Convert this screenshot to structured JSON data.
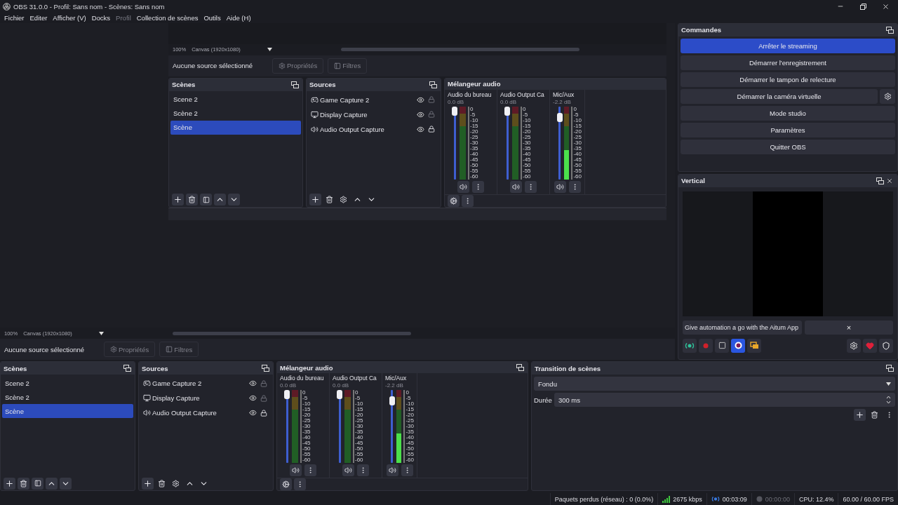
{
  "window": {
    "title": "OBS 31.0.0 - Profil: Sans nom - Scènes: Sans nom"
  },
  "menu": [
    {
      "label": "Fichier",
      "disabled": false
    },
    {
      "label": "Editer",
      "disabled": false
    },
    {
      "label": "Afficher (V)",
      "disabled": false
    },
    {
      "label": "Docks",
      "disabled": false
    },
    {
      "label": "Profil",
      "disabled": true
    },
    {
      "label": "Collection de scènes",
      "disabled": false
    },
    {
      "label": "Outils",
      "disabled": false
    },
    {
      "label": "Aide (H)",
      "disabled": false
    }
  ],
  "preview": {
    "capture": {
      "zoom_bar": {
        "zoom": "100%",
        "canvas": "Canvas (1920x1080)"
      },
      "info_bar": {
        "label": "Aucune source sélectionné",
        "buttons": [
          {
            "kind": "properties",
            "label": "Propriétés",
            "disabled": true
          },
          {
            "kind": "filters",
            "label": "Filtres",
            "disabled": true
          }
        ]
      },
      "scenes": {
        "title": "Scènes",
        "items": [
          {
            "label": "Scene 2",
            "selected": false
          },
          {
            "label": "Scène 2",
            "selected": false
          },
          {
            "label": "Scène",
            "selected": true
          }
        ]
      },
      "sources": {
        "title": "Sources",
        "items": [
          {
            "label": "Game Capture 2",
            "kind": "game",
            "visible": true,
            "locked": false
          },
          {
            "label": "Display Capture",
            "kind": "display",
            "visible": true,
            "locked": false
          },
          {
            "label": "Audio Output Capture",
            "kind": "audio",
            "visible": true,
            "locked": true
          }
        ]
      },
      "mixer": {
        "title": "Mélangeur audio",
        "channels": [
          {
            "name": "Audio du bureau",
            "reading": "0.0 dB",
            "volume": {
              "level": 1
            },
            "scale": [
              "0",
              "-5",
              "-10",
              "-15",
              "-20",
              "-25",
              "-30",
              "-35",
              "-40",
              "-45",
              "-50",
              "-55",
              "-60"
            ]
          },
          {
            "name": "Audio Output Ca",
            "reading": "0.0 dB",
            "volume": {
              "level": 1
            },
            "scale": [
              "0",
              "-5",
              "-10",
              "-15",
              "-20",
              "-25",
              "-30",
              "-35",
              "-40",
              "-45",
              "-50",
              "-55",
              "-60"
            ]
          },
          {
            "name": "Mic/Aux",
            "reading": "-2.2 dB",
            "volume": {
              "level": 0.9
            },
            "meter": {
              "level": 0.4
            },
            "scale": [
              "0",
              "-5",
              "-10",
              "-15",
              "-20",
              "-25",
              "-30",
              "-35",
              "-40",
              "-45",
              "-50",
              "-55",
              "-60"
            ]
          }
        ]
      }
    }
  },
  "zoom_bar": {
    "zoom": "100%",
    "canvas": "Canvas (1920x1080)"
  },
  "info_bar": {
    "label": "Aucune source sélectionné",
    "buttons": [
      {
        "kind": "properties",
        "label": "Propriétés",
        "disabled": true
      },
      {
        "kind": "filters",
        "label": "Filtres",
        "disabled": true
      }
    ]
  },
  "commands": {
    "title": "Commandes",
    "buttons": [
      {
        "label": "Arrêter le streaming",
        "active": true,
        "kind": "plain"
      },
      {
        "label": "Démarrer l'enregistrement",
        "active": false,
        "kind": "plain"
      },
      {
        "label": "Démarrer le tampon de relecture",
        "active": false,
        "kind": "plain"
      },
      {
        "label": "Démarrer la caméra virtuelle",
        "active": false,
        "kind": "with_settings"
      },
      {
        "label": "Mode studio",
        "active": false,
        "kind": "plain"
      },
      {
        "label": "Paramètres",
        "active": false,
        "kind": "plain"
      },
      {
        "label": "Quitter OBS",
        "active": false,
        "kind": "plain"
      }
    ]
  },
  "vertical": {
    "title": "Vertical",
    "closable": true,
    "banner": "Give automation a go with the Aitum App",
    "banner_close": "×",
    "toolbar": [
      {
        "kind": "stream",
        "active": false
      },
      {
        "kind": "record",
        "active": false
      },
      {
        "kind": "stop",
        "active": false
      },
      {
        "kind": "replay",
        "active": true
      },
      {
        "kind": "screens",
        "active": false
      },
      {
        "kind": "settings",
        "active": false
      },
      {
        "kind": "heart",
        "active": false
      },
      {
        "kind": "badge",
        "active": false
      }
    ]
  },
  "scenes": {
    "title": "Scènes",
    "items": [
      {
        "label": "Scene 2",
        "selected": false
      },
      {
        "label": "Scène 2",
        "selected": false
      },
      {
        "label": "Scène",
        "selected": true
      }
    ]
  },
  "sources": {
    "title": "Sources",
    "items": [
      {
        "label": "Game Capture 2",
        "kind": "game",
        "visible": true,
        "locked": false
      },
      {
        "label": "Display Capture",
        "kind": "display",
        "visible": true,
        "locked": false
      },
      {
        "label": "Audio Output Capture",
        "kind": "audio",
        "visible": true,
        "locked": true
      }
    ]
  },
  "mixer": {
    "title": "Mélangeur audio",
    "channels": [
      {
        "name": "Audio du bureau",
        "reading": "0.0 dB",
        "volume": {
          "level": 1
        },
        "scale": [
          "0",
          "-5",
          "-10",
          "-15",
          "-20",
          "-25",
          "-30",
          "-35",
          "-40",
          "-45",
          "-50",
          "-55",
          "-60"
        ]
      },
      {
        "name": "Audio Output Ca",
        "reading": "0.0 dB",
        "volume": {
          "level": 1
        },
        "scale": [
          "0",
          "-5",
          "-10",
          "-15",
          "-20",
          "-25",
          "-30",
          "-35",
          "-40",
          "-45",
          "-50",
          "-55",
          "-60"
        ]
      },
      {
        "name": "Mic/Aux",
        "reading": "-2.2 dB",
        "volume": {
          "level": 0.9
        },
        "meter": {
          "level": 0.4
        },
        "scale": [
          "0",
          "-5",
          "-10",
          "-15",
          "-20",
          "-25",
          "-30",
          "-35",
          "-40",
          "-45",
          "-50",
          "-55",
          "-60"
        ]
      }
    ]
  },
  "transition": {
    "title": "Transition de scènes",
    "select": {
      "value": "Fondu"
    },
    "duration": {
      "label": "Durée",
      "value": "300 ms"
    }
  },
  "status_bar": {
    "dropped": "Paquets perdus (réseau) : 0 (0.0%)",
    "bitrate": "2675 kbps",
    "streaming": true,
    "stream_time": "00:03:09",
    "recording": false,
    "record_time": "00:00:00",
    "cpu": "CPU: 12.4%",
    "fps": "60.00 / 60.00 FPS"
  }
}
